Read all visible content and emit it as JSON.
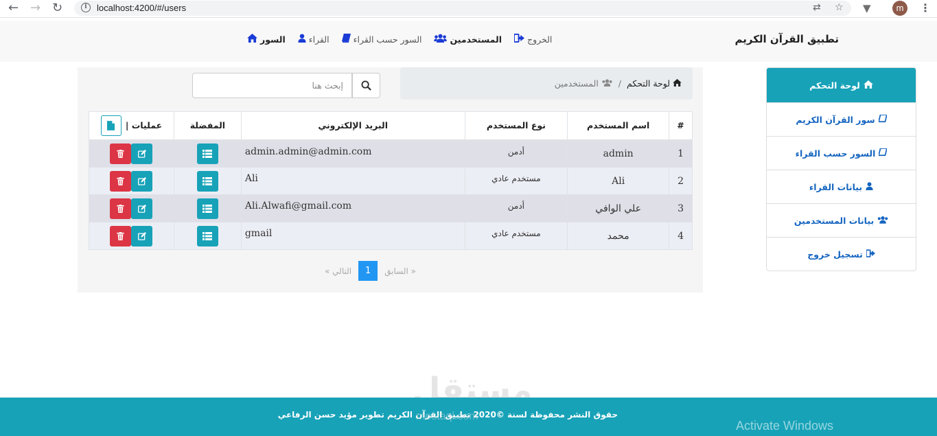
{
  "browser": {
    "url": "localhost:4200/#/users",
    "avatar_letter": "m"
  },
  "navbar": {
    "brand": "تطبيق القرآن الكريم",
    "links": [
      {
        "label": "السور",
        "icon": "home-icon"
      },
      {
        "label": "القراء",
        "icon": "user-icon"
      },
      {
        "label": "السور حسب القراء",
        "icon": "book-icon"
      },
      {
        "label": "المستخدمين",
        "icon": "users-icon"
      },
      {
        "label": "الخروج",
        "icon": "sign-out-icon"
      }
    ]
  },
  "sidebar": {
    "header": "لوحة التحكم",
    "items": [
      {
        "label": "سور القرآن الكريم",
        "icon": "book-icon"
      },
      {
        "label": "السور حسب القراء",
        "icon": "book-icon"
      },
      {
        "label": "بيانات القراء",
        "icon": "user-icon"
      },
      {
        "label": "بيانات المستخدمين",
        "icon": "users-icon"
      },
      {
        "label": "تسجيل خروج",
        "icon": "sign-out-icon"
      }
    ]
  },
  "breadcrumb": {
    "home": "لوحة التحكم",
    "separator": "/",
    "current": "المستخدمين"
  },
  "search": {
    "placeholder": "إبحث هنا"
  },
  "table": {
    "headers": {
      "index": "#",
      "username": "اسم المستخدم",
      "user_type": "نوع المستخدم",
      "email": "البريد الإلكتروني",
      "favorites": "المفضلة",
      "operations": "عمليات |"
    },
    "rows": [
      {
        "index": "1",
        "username": "admin",
        "user_type": "أدمن",
        "email": "admin.admin@admin.com"
      },
      {
        "index": "2",
        "username": "Ali",
        "user_type": "مستخدم عادي",
        "email": "Ali"
      },
      {
        "index": "3",
        "username": "علي الوافي",
        "user_type": "أدمن",
        "email": "Ali.Alwafi@gmail.com"
      },
      {
        "index": "4",
        "username": "محمد",
        "user_type": "مستخدم عادي",
        "email": "gmail"
      }
    ]
  },
  "pagination": {
    "prev": "« السابق",
    "current": "1",
    "next": "التالي »"
  },
  "footer": {
    "text": "حقوق النشر محفوظة لسنة ©2020 تطبيق القرآن الكريم تطوير مؤيد حسن الرفاعي"
  },
  "overlays": {
    "watermark": "مستقل",
    "watermark_sub": "mostaql.com",
    "activate": "Activate Windows"
  },
  "colors": {
    "accent": "#17a2b8",
    "danger": "#dc3545",
    "link": "#1565c0",
    "nav_icon": "#1a3bd6",
    "page_active": "#2196f3"
  }
}
